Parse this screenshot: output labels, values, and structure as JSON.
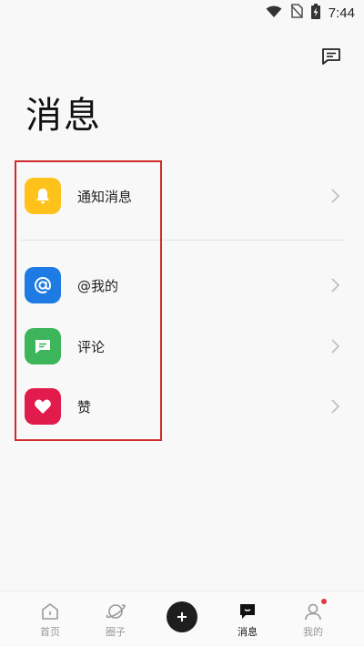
{
  "status_bar": {
    "time": "7:44"
  },
  "page": {
    "title": "消息"
  },
  "messages": {
    "items": [
      {
        "label": "通知消息",
        "icon": "bell-icon",
        "color": "#FFC21A"
      },
      {
        "label": "@我的",
        "icon": "at-icon",
        "color": "#1E7BE3"
      },
      {
        "label": "评论",
        "icon": "comment-icon",
        "color": "#3DB55B"
      },
      {
        "label": "赞",
        "icon": "heart-icon",
        "color": "#E11B4C"
      }
    ]
  },
  "bottom_nav": {
    "home": "首页",
    "circle": "圈子",
    "messages": "消息",
    "profile": "我的",
    "active": "消息"
  },
  "colors": {
    "highlight": "#CF2B2B",
    "notification_dot": "#E0383D"
  }
}
